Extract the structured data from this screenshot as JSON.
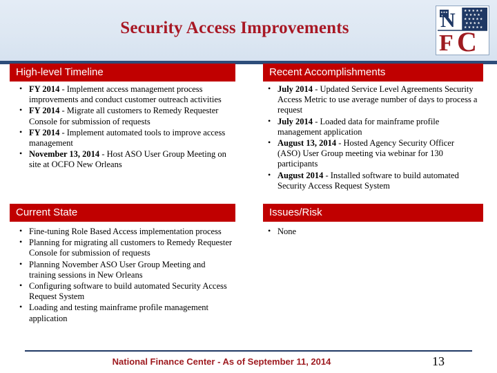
{
  "slide": {
    "title": "Security Access Improvements",
    "logo": {
      "name": "nfc-logo",
      "letters": "NFC",
      "alt": "National Finance Center logo"
    },
    "page_number": "13",
    "footer": "National Finance Center - As of September 11, 2014"
  },
  "panels": {
    "timeline": {
      "heading": "High-level Timeline",
      "items": [
        {
          "lead": "FY 2014",
          "text": " - Implement access management process improvements and conduct customer outreach activities"
        },
        {
          "lead": "FY 2014",
          "text": " - Migrate all customers to Remedy Requester Console for submission of requests"
        },
        {
          "lead": "FY 2014",
          "text": " - Implement automated tools to improve access management"
        },
        {
          "lead": "November 13, 2014",
          "text": " - Host ASO User Group Meeting on site at OCFO New Orleans"
        }
      ]
    },
    "accomplishments": {
      "heading": "Recent Accomplishments",
      "items": [
        {
          "lead": "July 2014",
          "text": " - Updated Service Level Agreements Security Access Metric to use average number of days to process a request"
        },
        {
          "lead": "July 2014",
          "text": " - Loaded data for mainframe profile management application"
        },
        {
          "lead": "August 13, 2014",
          "text": " - Hosted Agency Security Officer (ASO) User Group meeting via webinar for 130 participants"
        },
        {
          "lead": "August 2014",
          "text": " - Installed software to build automated Security Access Request System"
        }
      ]
    },
    "current_state": {
      "heading": "Current State",
      "items": [
        {
          "lead": "",
          "text": "Fine-tuning Role Based Access implementation process"
        },
        {
          "lead": "",
          "text": "Planning for migrating all customers to Remedy Requester Console for submission of requests"
        },
        {
          "lead": "",
          "text": "Planning November ASO User Group Meeting and training sessions in New Orleans"
        },
        {
          "lead": "",
          "text": "Configuring software to build automated Security Access Request System"
        },
        {
          "lead": "",
          "text": "Loading and testing mainframe profile management application"
        }
      ]
    },
    "issues_risk": {
      "heading": "Issues/Risk",
      "items": [
        {
          "lead": "",
          "text": "None"
        }
      ]
    }
  },
  "colors": {
    "bar_red": "#c00000",
    "title_red": "#a81825",
    "footer_red": "#9e1b20",
    "navy": "#2d4d7a",
    "header_bg": "#dde7f2"
  }
}
